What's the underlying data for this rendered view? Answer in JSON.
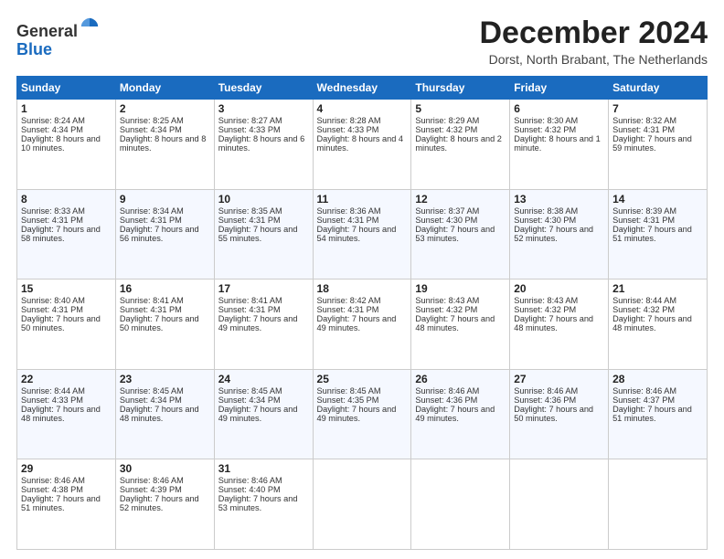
{
  "header": {
    "logo": {
      "line1": "General",
      "line2": "Blue"
    },
    "title": "December 2024",
    "subtitle": "Dorst, North Brabant, The Netherlands"
  },
  "calendar": {
    "days": [
      "Sunday",
      "Monday",
      "Tuesday",
      "Wednesday",
      "Thursday",
      "Friday",
      "Saturday"
    ],
    "weeks": [
      [
        {
          "day": "1",
          "sunrise": "Sunrise: 8:24 AM",
          "sunset": "Sunset: 4:34 PM",
          "daylight": "Daylight: 8 hours and 10 minutes."
        },
        {
          "day": "2",
          "sunrise": "Sunrise: 8:25 AM",
          "sunset": "Sunset: 4:34 PM",
          "daylight": "Daylight: 8 hours and 8 minutes."
        },
        {
          "day": "3",
          "sunrise": "Sunrise: 8:27 AM",
          "sunset": "Sunset: 4:33 PM",
          "daylight": "Daylight: 8 hours and 6 minutes."
        },
        {
          "day": "4",
          "sunrise": "Sunrise: 8:28 AM",
          "sunset": "Sunset: 4:33 PM",
          "daylight": "Daylight: 8 hours and 4 minutes."
        },
        {
          "day": "5",
          "sunrise": "Sunrise: 8:29 AM",
          "sunset": "Sunset: 4:32 PM",
          "daylight": "Daylight: 8 hours and 2 minutes."
        },
        {
          "day": "6",
          "sunrise": "Sunrise: 8:30 AM",
          "sunset": "Sunset: 4:32 PM",
          "daylight": "Daylight: 8 hours and 1 minute."
        },
        {
          "day": "7",
          "sunrise": "Sunrise: 8:32 AM",
          "sunset": "Sunset: 4:31 PM",
          "daylight": "Daylight: 7 hours and 59 minutes."
        }
      ],
      [
        {
          "day": "8",
          "sunrise": "Sunrise: 8:33 AM",
          "sunset": "Sunset: 4:31 PM",
          "daylight": "Daylight: 7 hours and 58 minutes."
        },
        {
          "day": "9",
          "sunrise": "Sunrise: 8:34 AM",
          "sunset": "Sunset: 4:31 PM",
          "daylight": "Daylight: 7 hours and 56 minutes."
        },
        {
          "day": "10",
          "sunrise": "Sunrise: 8:35 AM",
          "sunset": "Sunset: 4:31 PM",
          "daylight": "Daylight: 7 hours and 55 minutes."
        },
        {
          "day": "11",
          "sunrise": "Sunrise: 8:36 AM",
          "sunset": "Sunset: 4:31 PM",
          "daylight": "Daylight: 7 hours and 54 minutes."
        },
        {
          "day": "12",
          "sunrise": "Sunrise: 8:37 AM",
          "sunset": "Sunset: 4:30 PM",
          "daylight": "Daylight: 7 hours and 53 minutes."
        },
        {
          "day": "13",
          "sunrise": "Sunrise: 8:38 AM",
          "sunset": "Sunset: 4:30 PM",
          "daylight": "Daylight: 7 hours and 52 minutes."
        },
        {
          "day": "14",
          "sunrise": "Sunrise: 8:39 AM",
          "sunset": "Sunset: 4:31 PM",
          "daylight": "Daylight: 7 hours and 51 minutes."
        }
      ],
      [
        {
          "day": "15",
          "sunrise": "Sunrise: 8:40 AM",
          "sunset": "Sunset: 4:31 PM",
          "daylight": "Daylight: 7 hours and 50 minutes."
        },
        {
          "day": "16",
          "sunrise": "Sunrise: 8:41 AM",
          "sunset": "Sunset: 4:31 PM",
          "daylight": "Daylight: 7 hours and 50 minutes."
        },
        {
          "day": "17",
          "sunrise": "Sunrise: 8:41 AM",
          "sunset": "Sunset: 4:31 PM",
          "daylight": "Daylight: 7 hours and 49 minutes."
        },
        {
          "day": "18",
          "sunrise": "Sunrise: 8:42 AM",
          "sunset": "Sunset: 4:31 PM",
          "daylight": "Daylight: 7 hours and 49 minutes."
        },
        {
          "day": "19",
          "sunrise": "Sunrise: 8:43 AM",
          "sunset": "Sunset: 4:32 PM",
          "daylight": "Daylight: 7 hours and 48 minutes."
        },
        {
          "day": "20",
          "sunrise": "Sunrise: 8:43 AM",
          "sunset": "Sunset: 4:32 PM",
          "daylight": "Daylight: 7 hours and 48 minutes."
        },
        {
          "day": "21",
          "sunrise": "Sunrise: 8:44 AM",
          "sunset": "Sunset: 4:32 PM",
          "daylight": "Daylight: 7 hours and 48 minutes."
        }
      ],
      [
        {
          "day": "22",
          "sunrise": "Sunrise: 8:44 AM",
          "sunset": "Sunset: 4:33 PM",
          "daylight": "Daylight: 7 hours and 48 minutes."
        },
        {
          "day": "23",
          "sunrise": "Sunrise: 8:45 AM",
          "sunset": "Sunset: 4:34 PM",
          "daylight": "Daylight: 7 hours and 48 minutes."
        },
        {
          "day": "24",
          "sunrise": "Sunrise: 8:45 AM",
          "sunset": "Sunset: 4:34 PM",
          "daylight": "Daylight: 7 hours and 49 minutes."
        },
        {
          "day": "25",
          "sunrise": "Sunrise: 8:45 AM",
          "sunset": "Sunset: 4:35 PM",
          "daylight": "Daylight: 7 hours and 49 minutes."
        },
        {
          "day": "26",
          "sunrise": "Sunrise: 8:46 AM",
          "sunset": "Sunset: 4:36 PM",
          "daylight": "Daylight: 7 hours and 49 minutes."
        },
        {
          "day": "27",
          "sunrise": "Sunrise: 8:46 AM",
          "sunset": "Sunset: 4:36 PM",
          "daylight": "Daylight: 7 hours and 50 minutes."
        },
        {
          "day": "28",
          "sunrise": "Sunrise: 8:46 AM",
          "sunset": "Sunset: 4:37 PM",
          "daylight": "Daylight: 7 hours and 51 minutes."
        }
      ],
      [
        {
          "day": "29",
          "sunrise": "Sunrise: 8:46 AM",
          "sunset": "Sunset: 4:38 PM",
          "daylight": "Daylight: 7 hours and 51 minutes."
        },
        {
          "day": "30",
          "sunrise": "Sunrise: 8:46 AM",
          "sunset": "Sunset: 4:39 PM",
          "daylight": "Daylight: 7 hours and 52 minutes."
        },
        {
          "day": "31",
          "sunrise": "Sunrise: 8:46 AM",
          "sunset": "Sunset: 4:40 PM",
          "daylight": "Daylight: 7 hours and 53 minutes."
        },
        null,
        null,
        null,
        null
      ]
    ]
  }
}
